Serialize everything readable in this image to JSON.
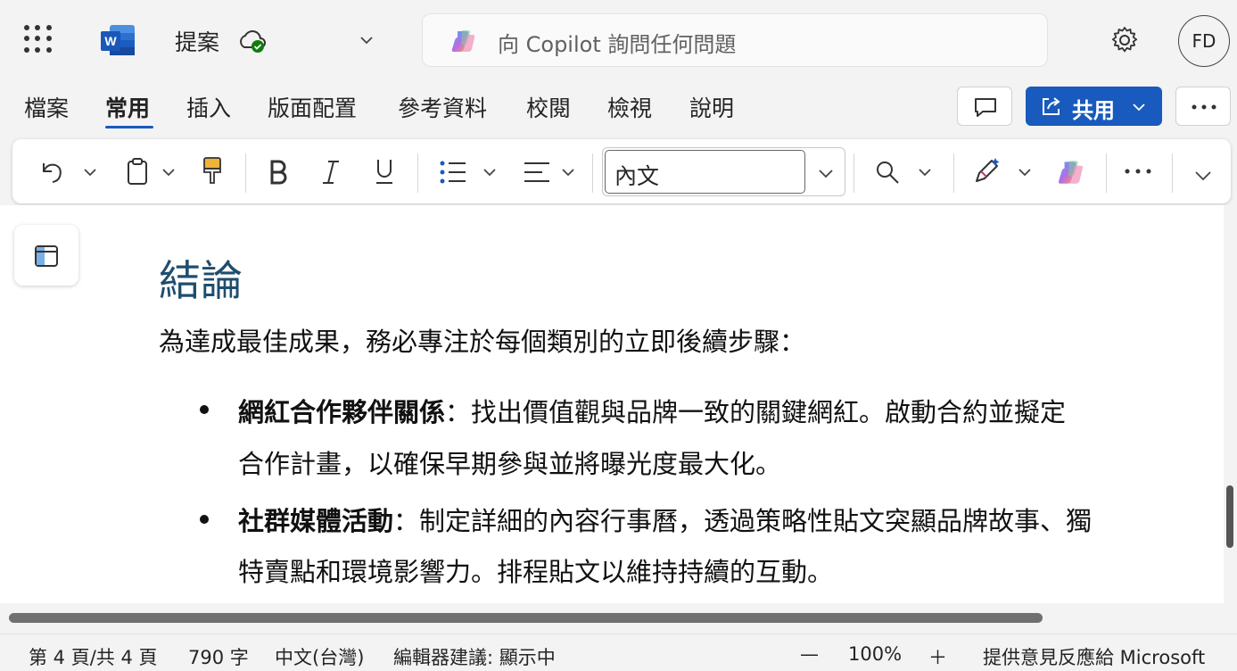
{
  "app": {
    "doc_title": "提案",
    "copilot_placeholder": "向 Copilot 詢問任何問題",
    "avatar_initials": "FD",
    "brand_color": "#185abd"
  },
  "tabs": [
    {
      "label": "檔案"
    },
    {
      "label": "常用",
      "active": true
    },
    {
      "label": "插入"
    },
    {
      "label": "版面配置"
    },
    {
      "label": "參考資料"
    },
    {
      "label": "校閱"
    },
    {
      "label": "檢視"
    },
    {
      "label": "說明"
    }
  ],
  "share": {
    "label": "共用"
  },
  "ribbon": {
    "style_value": "內文",
    "icons": [
      "undo-icon",
      "clipboard-icon",
      "format-painter-icon",
      "bold-icon",
      "italic-icon",
      "underline-icon",
      "bullets-icon",
      "align-icon",
      "find-icon",
      "editor-icon",
      "copilot-icon",
      "more-icon",
      "expand-icon"
    ]
  },
  "document": {
    "heading": "結論",
    "intro": "為達成最佳成果，務必專注於每個類別的立即後續步驟：",
    "bullets": [
      {
        "title": "網紅合作夥伴關係",
        "line1": "：找出價值觀與品牌一致的關鍵網紅。啟動合約並擬定",
        "line2": "合作計畫，以確保早期參與並將曝光度最大化。"
      },
      {
        "title": "社群媒體活動",
        "line1": "：制定詳細的內容行事曆，透過策略性貼文突顯品牌故事、獨",
        "line2": "特賣點和環境影響力。排程貼文以維持持續的互動。"
      }
    ]
  },
  "status": {
    "page": "第 4 頁/共 4 頁",
    "words": "790 字",
    "language": "中文(台灣)",
    "editor": "編輯器建議: 顯示中",
    "zoom_out": "—",
    "zoom": "100%",
    "zoom_in": "＋",
    "feedback": "提供意見反應給 Microsoft"
  }
}
